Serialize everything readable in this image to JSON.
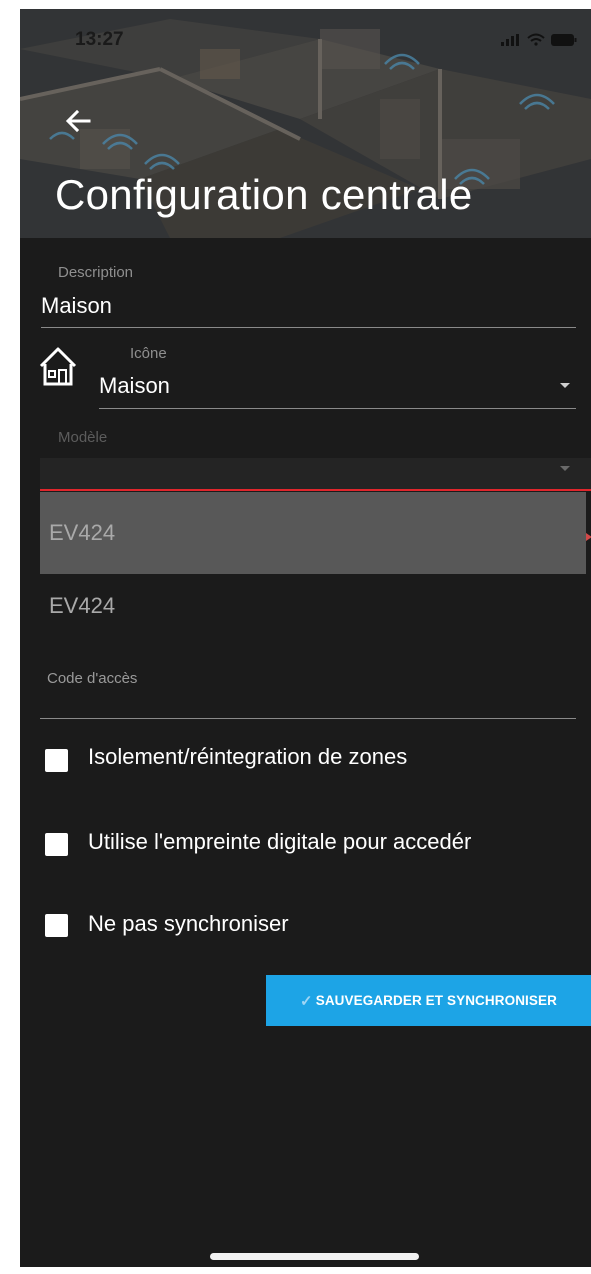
{
  "status_bar": {
    "time": "13:27",
    "icons": [
      "signal-icon",
      "wifi-icon",
      "battery-icon"
    ]
  },
  "header": {
    "back_icon": "arrow-left-icon",
    "title": "Configuration centrale"
  },
  "form": {
    "description": {
      "label": "Description",
      "value": "Maison"
    },
    "icon_field": {
      "label": "Icône",
      "value": "Maison",
      "icon": "house-icon"
    },
    "model": {
      "label": "Modèle",
      "value": "",
      "options": [
        "EV424",
        "EV424"
      ]
    },
    "access_code": {
      "label": "Code d'accès",
      "value": ""
    },
    "checkboxes": [
      {
        "label": "Isolement/réintegration de zones",
        "checked": false
      },
      {
        "label": "Utilise l'empreinte digitale pour accedér",
        "checked": false
      },
      {
        "label": "Ne pas synchroniser",
        "checked": false
      }
    ],
    "save_button": {
      "label": "SAUVEGARDER ET SYNCHRONISER",
      "icon": "check-icon"
    }
  },
  "colors": {
    "background": "#1b1b1b",
    "accent": "#1da4e6",
    "error_line": "#e0262c",
    "highlight_option": "#585858"
  }
}
